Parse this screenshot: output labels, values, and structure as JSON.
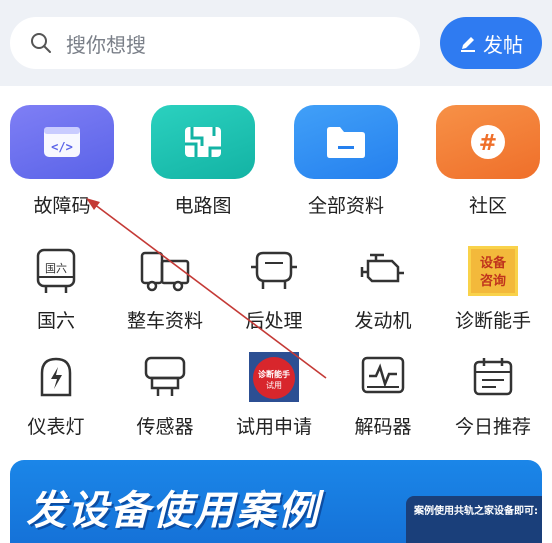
{
  "search": {
    "placeholder": "搜你想搜",
    "icon": "search-icon"
  },
  "post_button": {
    "label": "发帖",
    "icon": "pen-icon",
    "color": "#2f7bf1"
  },
  "featured": [
    {
      "label": "故障码",
      "icon": "code-icon",
      "color": "#6b6ff0"
    },
    {
      "label": "电路图",
      "icon": "circuit-icon",
      "color": "#1fc0b0"
    },
    {
      "label": "全部资料",
      "icon": "folder-icon",
      "color": "#2f8cf5"
    },
    {
      "label": "社区",
      "icon": "hashtag-icon",
      "color": "#f2813a"
    }
  ],
  "grid": [
    {
      "label": "国六",
      "icon": "bus-icon",
      "badge": "国六"
    },
    {
      "label": "整车资料",
      "icon": "truck-icon"
    },
    {
      "label": "后处理",
      "icon": "exhaust-icon"
    },
    {
      "label": "发动机",
      "icon": "engine-icon"
    },
    {
      "label": "诊断能手",
      "icon": "diagnosis-badge-icon",
      "badge": "设备 咨询"
    },
    {
      "label": "仪表灯",
      "icon": "warning-lamp-icon"
    },
    {
      "label": "传感器",
      "icon": "sensor-icon"
    },
    {
      "label": "试用申请",
      "icon": "trial-badge-icon",
      "badge": "诊断能手 试用"
    },
    {
      "label": "解码器",
      "icon": "decoder-icon"
    },
    {
      "label": "今日推荐",
      "icon": "calendar-icon"
    }
  ],
  "banner": {
    "title": "发设备使用案例",
    "card_text": "案例使用共轨之家设备即可:"
  }
}
